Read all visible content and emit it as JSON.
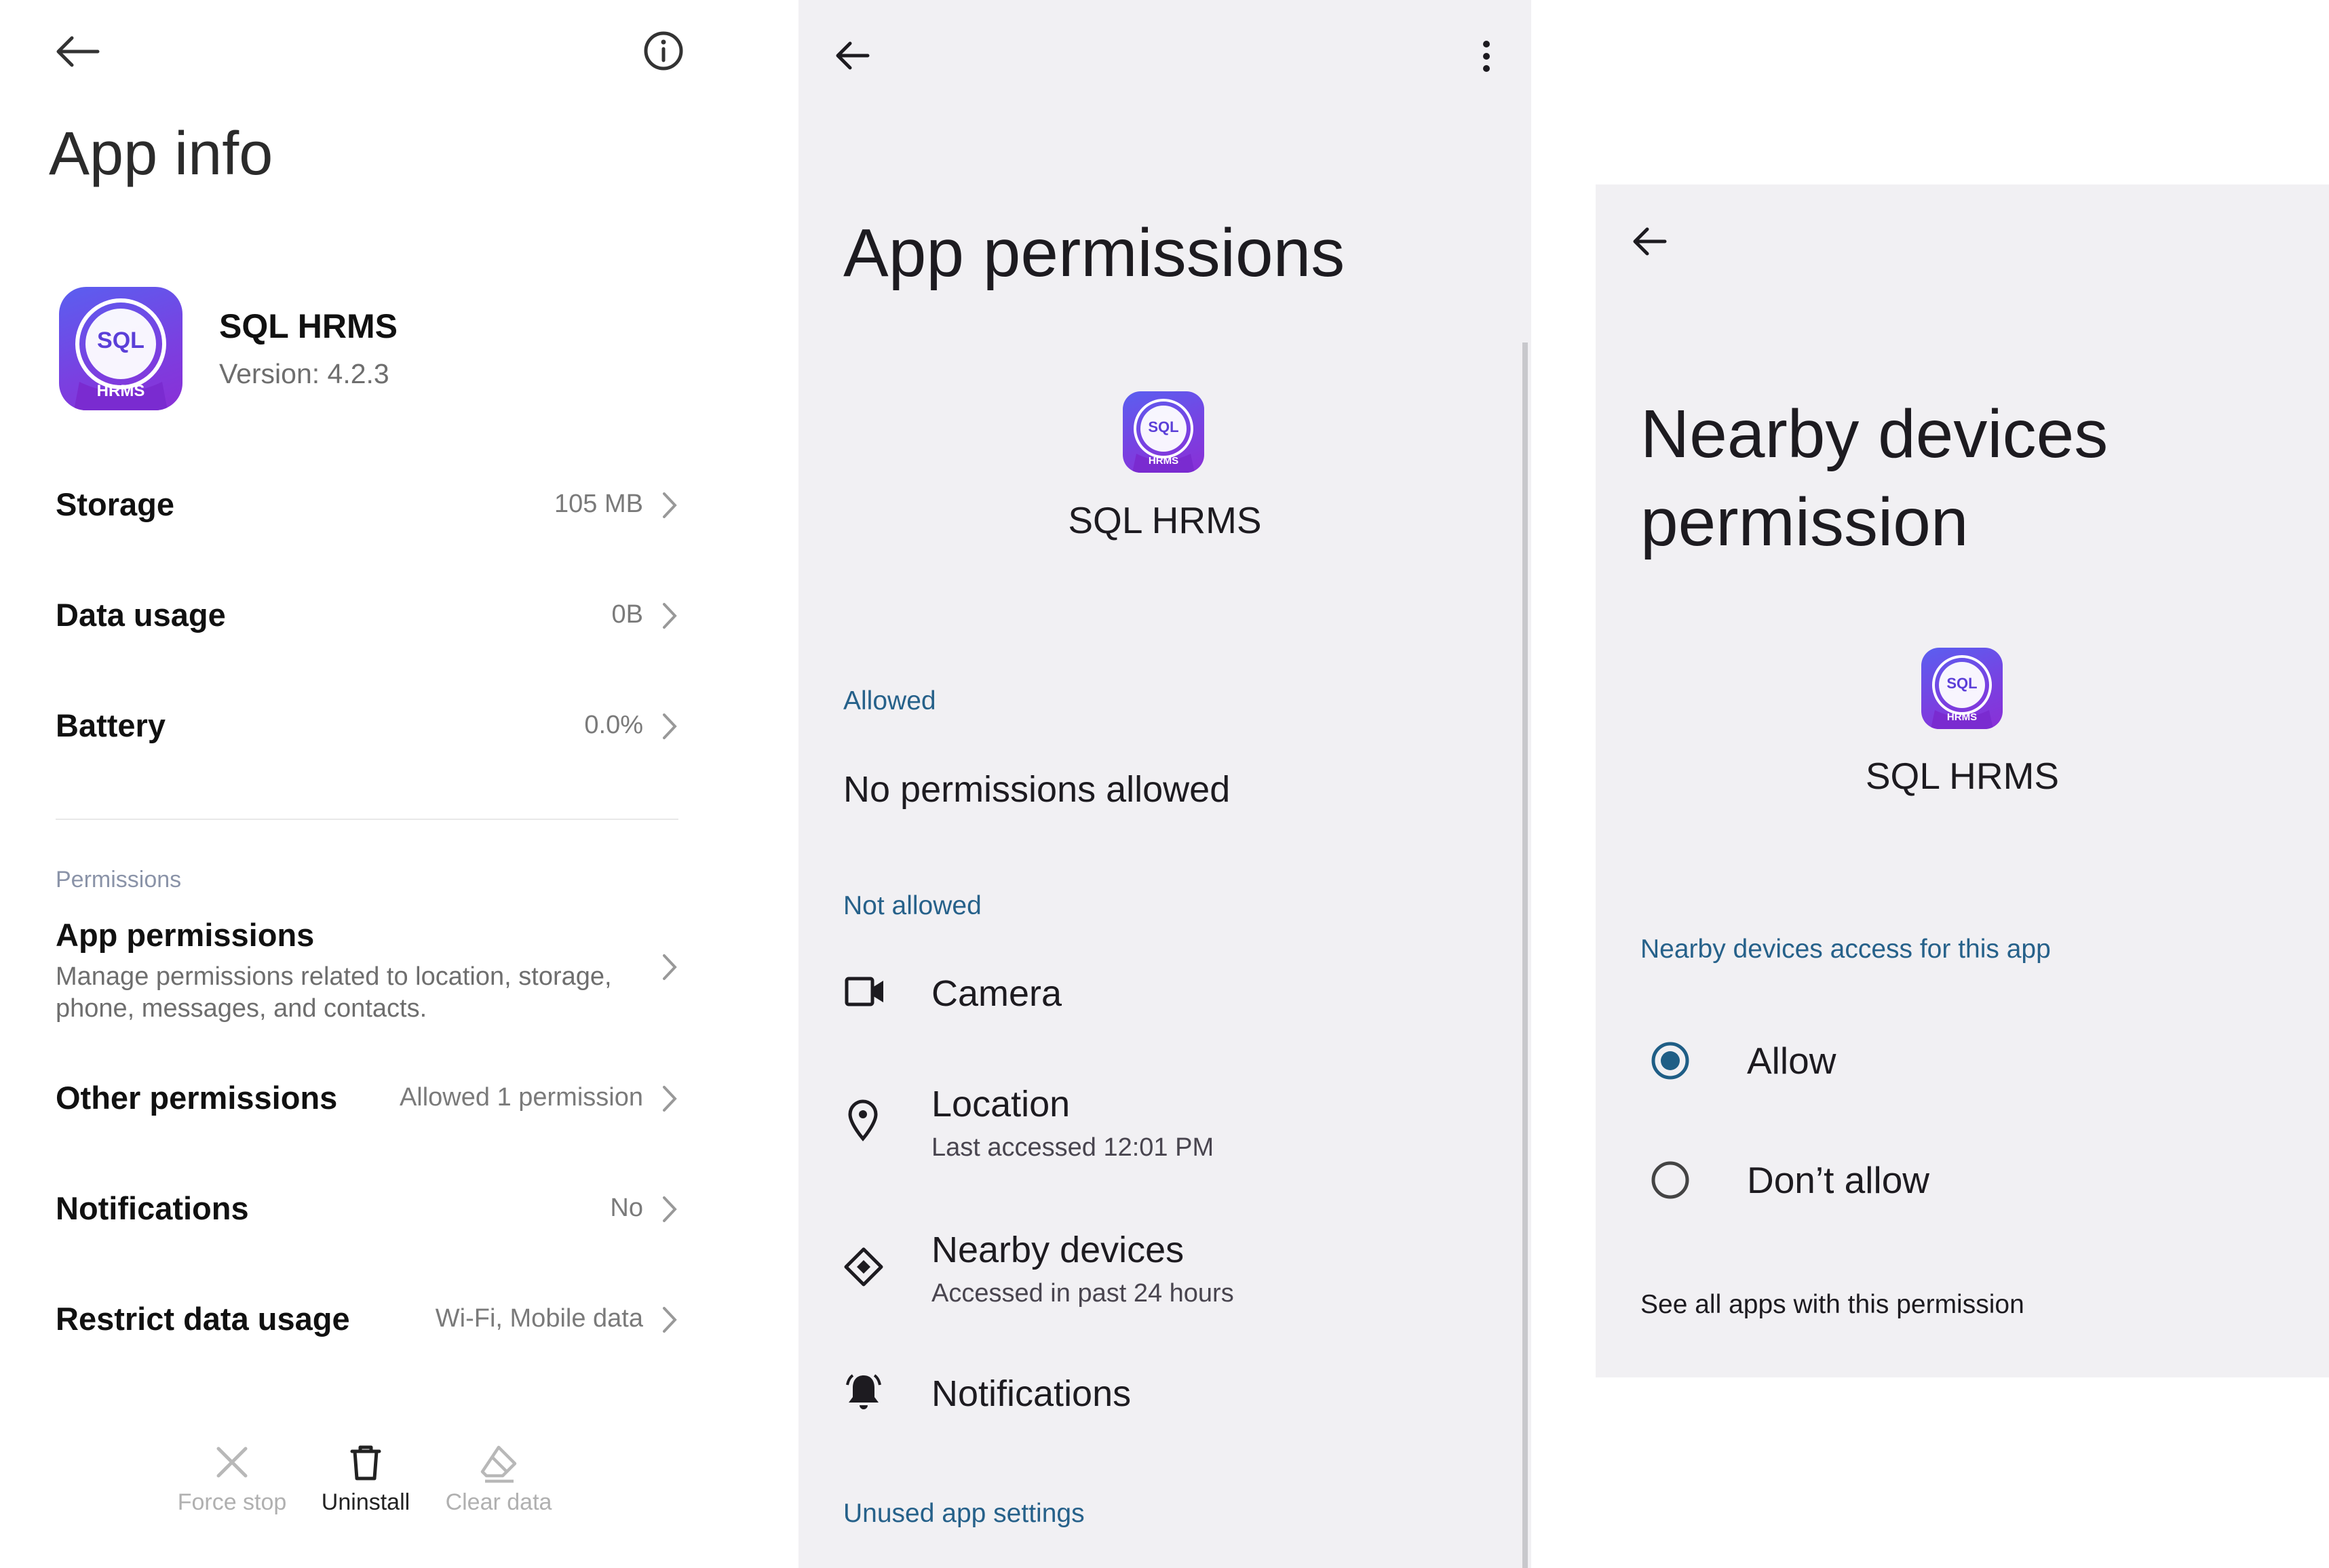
{
  "app_info": {
    "title": "App info",
    "app_name": "SQL HRMS",
    "version": "Version: 4.2.3",
    "rows": [
      {
        "label": "Storage",
        "value": "105 MB"
      },
      {
        "label": "Data usage",
        "value": "0B"
      },
      {
        "label": "Battery",
        "value": "0.0%"
      }
    ],
    "permissions_section": "Permissions",
    "app_permissions": {
      "label": "App permissions",
      "description_line1": "Manage permissions related to location, storage,",
      "description_line2": "phone, messages, and contacts."
    },
    "rows2": [
      {
        "label": "Other permissions",
        "value": "Allowed 1 permission"
      },
      {
        "label": "Notifications",
        "value": "No"
      },
      {
        "label": "Restrict data usage",
        "value": "Wi-Fi, Mobile data"
      }
    ],
    "actions": {
      "force_stop": "Force stop",
      "uninstall": "Uninstall",
      "clear_data": "Clear data"
    }
  },
  "app_permissions": {
    "title": "App permissions",
    "app_name": "SQL HRMS",
    "allowed_header": "Allowed",
    "no_permissions": "No permissions allowed",
    "not_allowed_header": "Not allowed",
    "items": [
      {
        "title": "Camera",
        "subtitle": "",
        "icon": "camera-icon"
      },
      {
        "title": "Location",
        "subtitle": "Last accessed 12:01 PM",
        "icon": "location-pin-icon"
      },
      {
        "title": "Nearby devices",
        "subtitle": "Accessed in past 24 hours",
        "icon": "nearby-devices-icon"
      },
      {
        "title": "Notifications",
        "subtitle": "",
        "icon": "bell-icon"
      }
    ],
    "unused_header": "Unused app settings"
  },
  "nearby_permission": {
    "title_line1": "Nearby devices",
    "title_line2": "permission",
    "app_name": "SQL HRMS",
    "section": "Nearby devices access for this app",
    "options": [
      {
        "label": "Allow",
        "selected": true
      },
      {
        "label": "Don’t allow",
        "selected": false
      }
    ],
    "see_all": "See all apps with this permission"
  },
  "icon_text": {
    "logo": "SQL",
    "badge": "HRMS"
  },
  "colors": {
    "accent": "#26618a",
    "radio_selected": "#1f5e86",
    "panel_bg": "#f1f0f3",
    "icon_gradient_start": "#5a5ff0",
    "icon_gradient_end": "#8a2fd6"
  }
}
